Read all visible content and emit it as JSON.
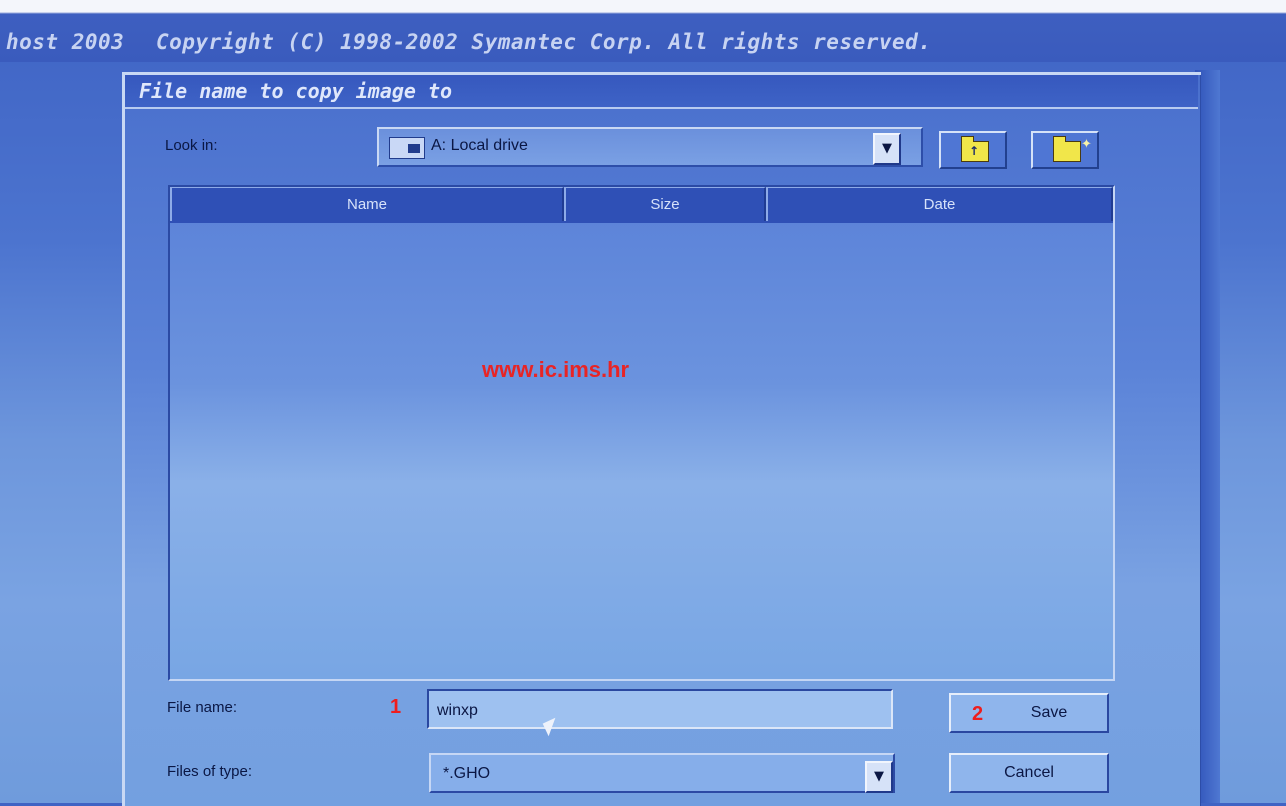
{
  "app": {
    "product_left": "host 2003",
    "copyright": "Copyright (C) 1998-2002 Symantec Corp. All rights reserved."
  },
  "dialog": {
    "title": "File name to copy image to",
    "look_in_label": "Look in:",
    "look_in_value": "A: Local drive",
    "columns": [
      "Name",
      "Size",
      "Date"
    ],
    "file_name_label": "File name:",
    "file_name_value": "winxp",
    "files_of_type_label": "Files of type:",
    "files_of_type_value": "*.GHO",
    "save_label": "Save",
    "cancel_label": "Cancel"
  },
  "overlay": {
    "watermark": "www.ic.ims.hr",
    "step1": "1",
    "step2": "2"
  },
  "icons": {
    "drive": "drive-icon",
    "dropdown": "chevron-down-icon",
    "up_folder": "up-folder-icon",
    "new_folder": "new-folder-icon"
  },
  "colors": {
    "background": "#4a70cd",
    "titlebar": "#3658be",
    "annotation_red": "#ee1d1d"
  }
}
